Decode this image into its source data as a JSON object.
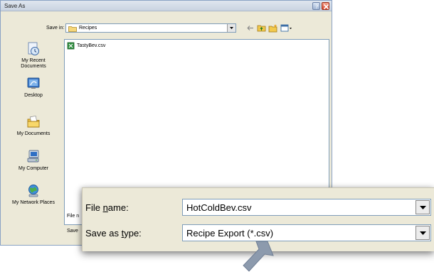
{
  "window": {
    "title": "Save As"
  },
  "save_in": {
    "label": "Save in:",
    "value": "Recipes"
  },
  "places": [
    {
      "label": "My Recent Documents",
      "icon": "recent-documents-icon"
    },
    {
      "label": "Desktop",
      "icon": "desktop-icon"
    },
    {
      "label": "My Documents",
      "icon": "my-documents-icon"
    },
    {
      "label": "My Computer",
      "icon": "my-computer-icon"
    },
    {
      "label": "My Network Places",
      "icon": "network-places-icon"
    }
  ],
  "files": [
    {
      "name": "TastyBev.csv",
      "icon": "csv-file-icon"
    }
  ],
  "small_form": {
    "file_name_label": "File n",
    "save_type_label": "Save"
  },
  "callout": {
    "file_name_label": "File name:",
    "file_name_value": "HotColdBev.csv",
    "save_type_label": "Save as type:",
    "save_type_value": "Recipe Export (*.csv)"
  },
  "colors": {
    "dialog_bg": "#ece9d8",
    "field_border": "#7f9db9",
    "pointer": "#8c9aad"
  }
}
